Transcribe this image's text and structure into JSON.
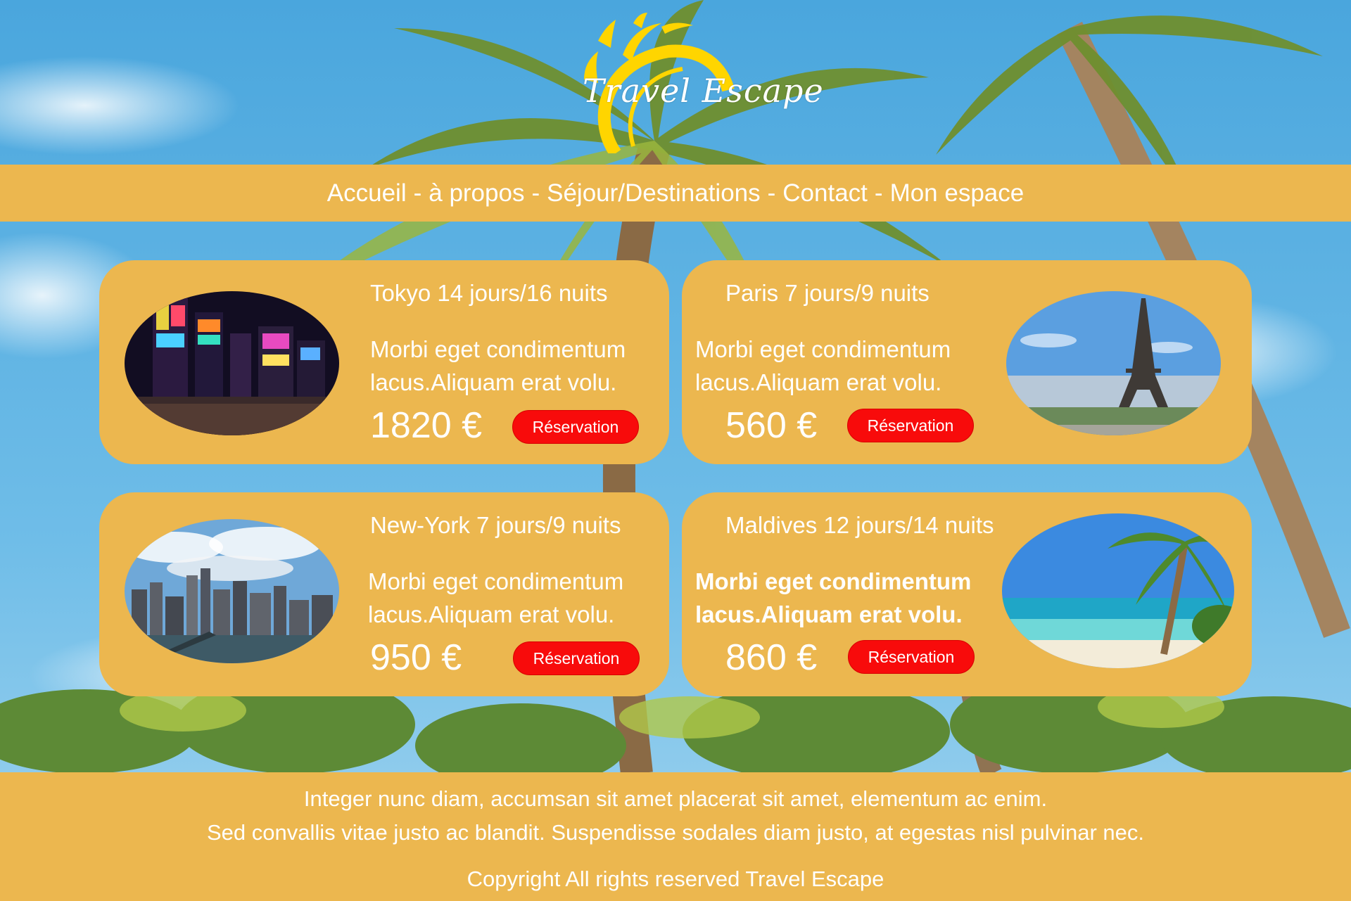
{
  "brand": {
    "logo_text": "Travel Escape"
  },
  "nav": {
    "items": [
      "Accueil",
      "à propos",
      "Séjour/Destinations",
      "Contact",
      "Mon espace"
    ],
    "separator": "-"
  },
  "cards": [
    {
      "title": "Tokyo 14 jours/16 nuits",
      "desc_line1": "Morbi eget condimentum",
      "desc_line2": "lacus.Aliquam erat volu.",
      "price": "1820 €",
      "button": "Réservation"
    },
    {
      "title": "Paris 7 jours/9 nuits",
      "desc_line1": "Morbi eget condimentum",
      "desc_line2": "lacus.Aliquam erat volu.",
      "price": "560 €",
      "button": "Réservation"
    },
    {
      "title": "New-York 7 jours/9 nuits",
      "desc_line1": "Morbi eget condimentum",
      "desc_line2": "lacus.Aliquam erat volu.",
      "price": "950 €",
      "button": "Réservation"
    },
    {
      "title": "Maldives 12 jours/14 nuits",
      "desc_line1": "Morbi eget condimentum",
      "desc_line2": "lacus.Aliquam erat volu.",
      "price": "860 €",
      "button": "Réservation"
    }
  ],
  "footer": {
    "line1": "Integer nunc diam, accumsan sit amet placerat sit amet, elementum ac enim.",
    "line2": "Sed convallis vitae justo ac blandit. Suspendisse sodales diam justo, at egestas nisl pulvinar nec.",
    "copyright": "Copyright All rights reserved Travel Escape"
  },
  "colors": {
    "accent": "#ecb74f",
    "button": "#f80b0b",
    "sky": "#57aee0",
    "text": "#ffffff"
  }
}
